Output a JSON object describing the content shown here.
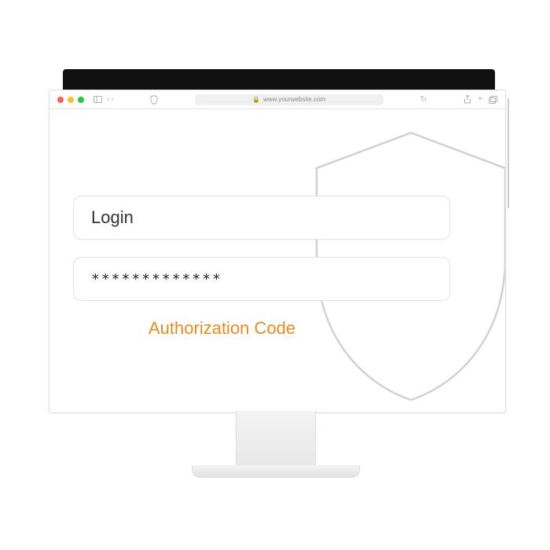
{
  "browser": {
    "url_display": "www.yourwebsite.com",
    "icons": {
      "sidebar": "sidebar-icon",
      "back": "chevron-left-icon",
      "forward": "chevron-right-icon",
      "shield": "shield-icon",
      "lock": "lock-icon",
      "refresh": "refresh-icon",
      "share": "share-icon",
      "new_tab": "plus-icon",
      "tabs": "tabs-icon"
    }
  },
  "form": {
    "login_value": "Login",
    "password_value": "*************",
    "auth_link": "Authorization Code"
  },
  "colors": {
    "accent": "#e78b1f",
    "border": "#e3e3e3",
    "shield_stroke": "#c9c9c9"
  }
}
